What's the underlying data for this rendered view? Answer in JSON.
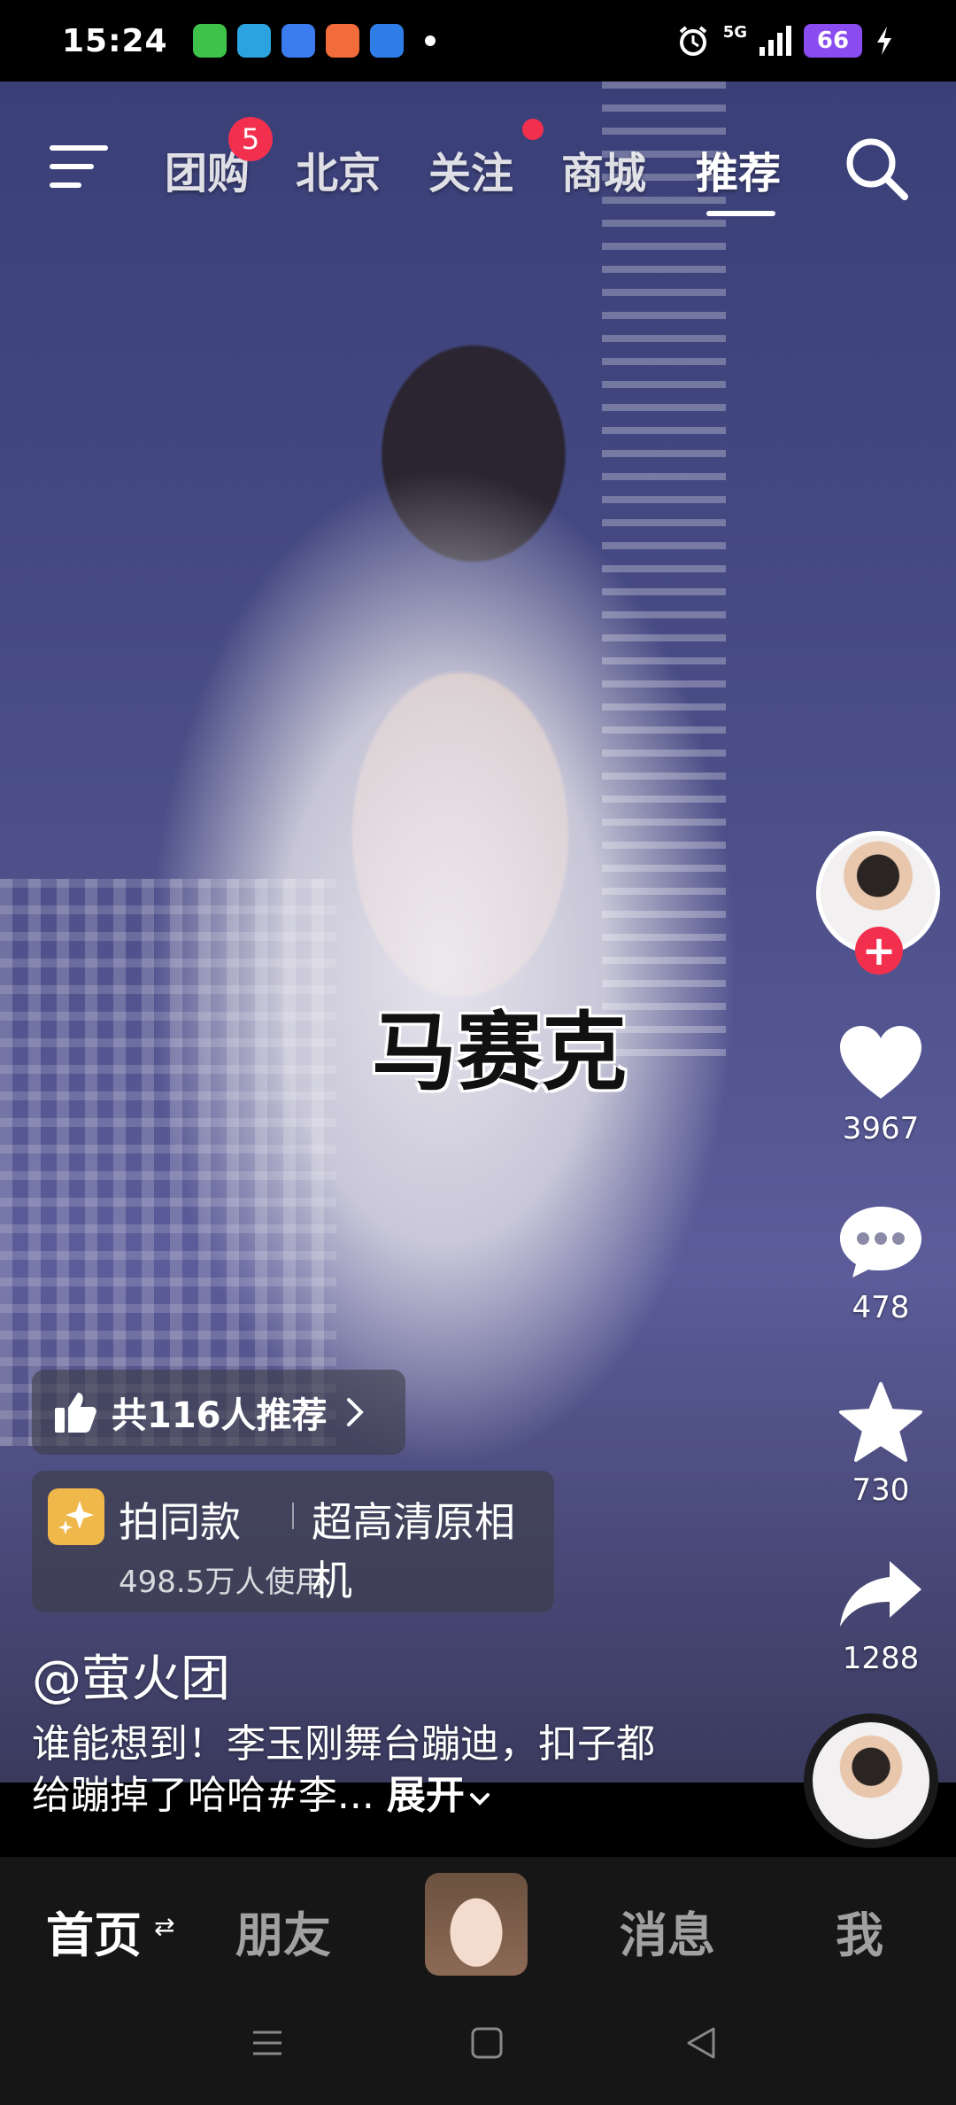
{
  "status_bar": {
    "time": "15:24",
    "network": "5G",
    "battery": "66",
    "app_icons": [
      {
        "name": "wechat-icon",
        "color": "#3ec24a"
      },
      {
        "name": "telegram-icon",
        "color": "#2aa3e0"
      },
      {
        "name": "files-icon",
        "color": "#3b7cf0"
      },
      {
        "name": "weibo-icon",
        "color": "#f26b3a"
      },
      {
        "name": "browser-icon",
        "color": "#2f7ee8"
      }
    ]
  },
  "top_nav": {
    "tabs": [
      "团购",
      "北京",
      "关注",
      "商城",
      "推荐"
    ],
    "active_tab": "推荐",
    "group_buy_badge": "5"
  },
  "video": {
    "caption": "马赛克"
  },
  "actions": {
    "likes": "3967",
    "comments": "478",
    "favorites": "730",
    "shares": "1288"
  },
  "recommend": {
    "label": "共116人推荐"
  },
  "template": {
    "name": "拍同款",
    "desc": "超高清原相机",
    "usage": "498.5万人使用"
  },
  "post": {
    "author": "@萤火团",
    "description": "谁能想到！李玉刚舞台蹦迪，扣子都给蹦掉了哈哈#李...",
    "expand": "展开"
  },
  "bottom_nav": {
    "tabs": [
      "首页",
      "朋友",
      "消息",
      "我"
    ]
  },
  "colors": {
    "accent": "#f2304e",
    "battery": "#8a4cf0"
  }
}
